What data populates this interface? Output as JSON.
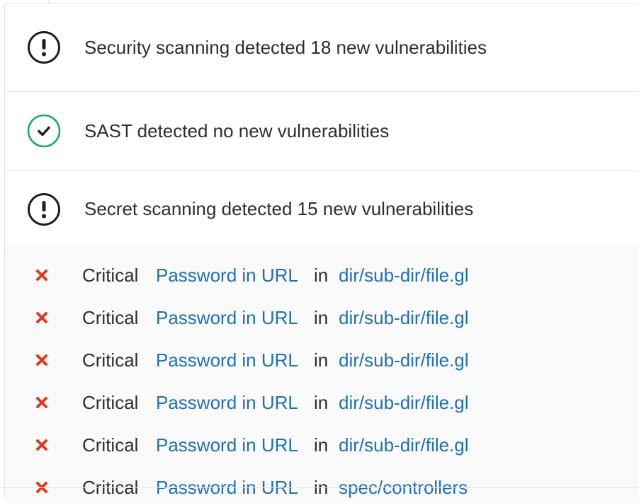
{
  "colors": {
    "warning_icon": "#1f1f1f",
    "success_icon": "#1aaa55",
    "critical_x": "#db3b21",
    "link": "#1f6fb5",
    "text": "#2e2e2e",
    "details_bg": "#fafafa",
    "border": "#e2e2e2"
  },
  "sections": [
    {
      "icon": "warning-icon",
      "text": "Security scanning detected 18 new vulnerabilities"
    },
    {
      "icon": "success-check-icon",
      "text": "SAST detected no new vulnerabilities"
    },
    {
      "icon": "warning-icon",
      "text": "Secret scanning detected 15 new vulnerabilities"
    }
  ],
  "findings": [
    {
      "severity": "Critical",
      "title": "Password in URL",
      "in": "in",
      "path": "dir/sub-dir/file.gl"
    },
    {
      "severity": "Critical",
      "title": "Password in URL",
      "in": "in",
      "path": "dir/sub-dir/file.gl"
    },
    {
      "severity": "Critical",
      "title": "Password in URL",
      "in": "in",
      "path": "dir/sub-dir/file.gl"
    },
    {
      "severity": "Critical",
      "title": "Password in URL",
      "in": "in",
      "path": "dir/sub-dir/file.gl"
    },
    {
      "severity": "Critical",
      "title": "Password in URL",
      "in": "in",
      "path": "dir/sub-dir/file.gl"
    },
    {
      "severity": "Critical",
      "title": "Password in URL",
      "in": "in",
      "path": "spec/controllers"
    }
  ]
}
